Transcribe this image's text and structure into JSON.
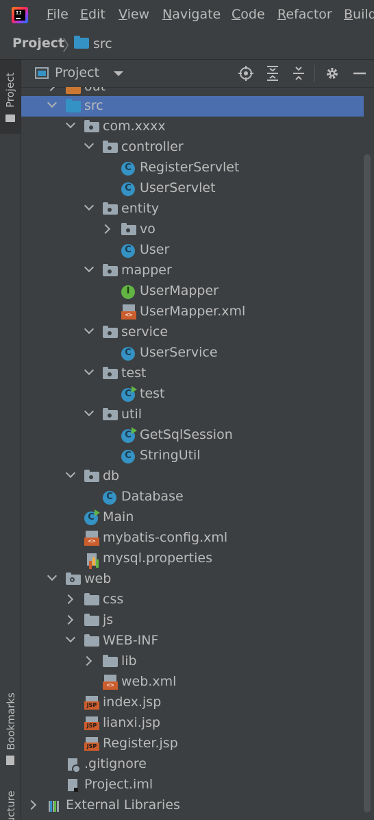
{
  "menu": {
    "items": [
      {
        "mnemonic": "F",
        "rest": "ile"
      },
      {
        "mnemonic": "E",
        "rest": "dit"
      },
      {
        "mnemonic": "V",
        "rest": "iew"
      },
      {
        "mnemonic": "N",
        "rest": "avigate"
      },
      {
        "mnemonic": "C",
        "rest": "ode"
      },
      {
        "mnemonic": "R",
        "rest": "efactor"
      },
      {
        "mnemonic": "B",
        "rest": "uild"
      }
    ]
  },
  "breadcrumb": {
    "project": "Project",
    "folder": "src"
  },
  "stripe": {
    "project_tab": "Project",
    "bookmarks_tab": "Bookmarks",
    "structure_tab": "Structure"
  },
  "panel": {
    "title": "Project"
  },
  "tree": [
    {
      "label": "out",
      "icon": "folder-excluded-icon"
    },
    {
      "label": "src",
      "icon": "source-folder-icon"
    },
    {
      "label": "com.xxxx",
      "icon": "package-icon"
    },
    {
      "label": "controller",
      "icon": "package-icon"
    },
    {
      "label": "RegisterServlet",
      "icon": "class-icon"
    },
    {
      "label": "UserServlet",
      "icon": "class-icon"
    },
    {
      "label": "entity",
      "icon": "package-icon"
    },
    {
      "label": "vo",
      "icon": "package-icon"
    },
    {
      "label": "User",
      "icon": "class-icon"
    },
    {
      "label": "mapper",
      "icon": "package-icon"
    },
    {
      "label": "UserMapper",
      "icon": "interface-icon"
    },
    {
      "label": "UserMapper.xml",
      "icon": "xml-file-icon"
    },
    {
      "label": "service",
      "icon": "package-icon"
    },
    {
      "label": "UserService",
      "icon": "class-icon"
    },
    {
      "label": "test",
      "icon": "package-icon"
    },
    {
      "label": "test",
      "icon": "runnable-class-icon"
    },
    {
      "label": "util",
      "icon": "package-icon"
    },
    {
      "label": "GetSqlSession",
      "icon": "runnable-class-icon"
    },
    {
      "label": "StringUtil",
      "icon": "class-icon"
    },
    {
      "label": "db",
      "icon": "package-icon"
    },
    {
      "label": "Database",
      "icon": "class-icon"
    },
    {
      "label": "Main",
      "icon": "runnable-class-icon"
    },
    {
      "label": "mybatis-config.xml",
      "icon": "xml-file-icon"
    },
    {
      "label": "mysql.properties",
      "icon": "properties-file-icon"
    },
    {
      "label": "web",
      "icon": "web-folder-icon"
    },
    {
      "label": "css",
      "icon": "folder-icon"
    },
    {
      "label": "js",
      "icon": "folder-icon"
    },
    {
      "label": "WEB-INF",
      "icon": "folder-icon"
    },
    {
      "label": "lib",
      "icon": "folder-icon"
    },
    {
      "label": "web.xml",
      "icon": "web-xml-icon"
    },
    {
      "label": "index.jsp",
      "icon": "jsp-file-icon"
    },
    {
      "label": "lianxi.jsp",
      "icon": "jsp-file-icon"
    },
    {
      "label": "Register.jsp",
      "icon": "jsp-file-icon"
    },
    {
      "label": ".gitignore",
      "icon": "gitignore-file-icon"
    },
    {
      "label": "Project.iml",
      "icon": "iml-file-icon"
    },
    {
      "label": "External Libraries",
      "icon": "libraries-icon"
    }
  ],
  "colors": {
    "selection": "#4b6eaf",
    "background": "#3c3f41",
    "class": "#3592c4",
    "interface": "#62b543",
    "xml": "#cc5d2c"
  }
}
